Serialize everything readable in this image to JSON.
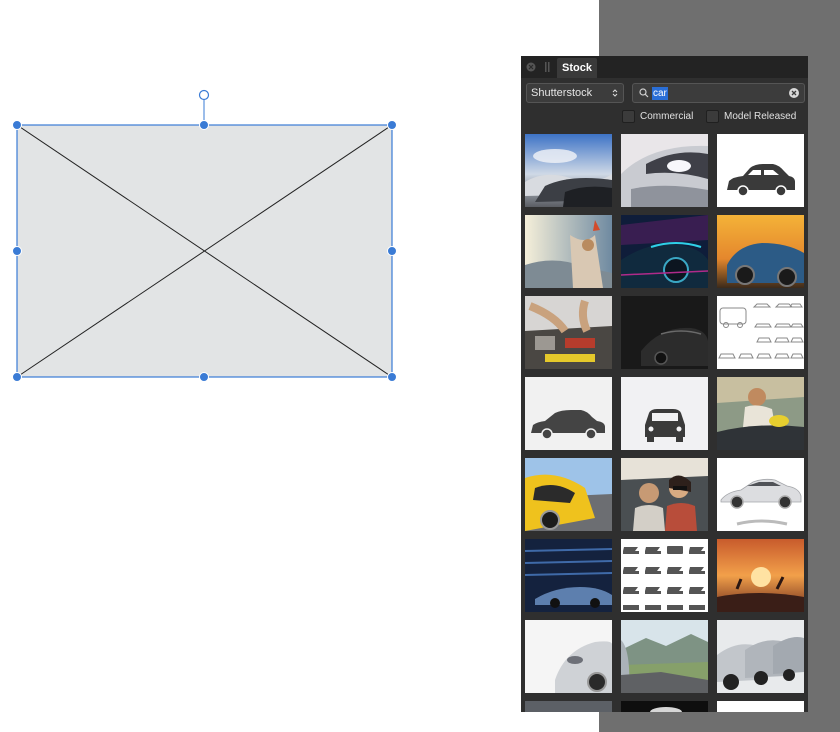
{
  "stock_panel": {
    "tab_title": "Stock",
    "source": "Shutterstock",
    "search_query": "car",
    "filters": [
      {
        "label": "Commercial",
        "checked": false
      },
      {
        "label": "Model Released",
        "checked": false
      }
    ],
    "thumbnails": [
      "cars-parked-row-photo",
      "car-headlight-closeup-photo",
      "car-silhouette-icon",
      "woman-in-car-sunset-photo",
      "dark-sports-car-neon-photo",
      "blue-car-sunset-photo",
      "mechanic-engine-repair-photo",
      "black-car-dark-photo",
      "car-outline-icons-set",
      "car-silhouette-icon-side",
      "car-front-icon",
      "man-washing-car-photo",
      "yellow-car-road-photo",
      "couple-driving-car-photo",
      "white-sedan-photo",
      "car-motion-blur-photo",
      "car-icons-grid",
      "friends-car-sunset-photo",
      "white-car-front-photo",
      "car-mountain-road-photo",
      "cars-dealership-row-photo",
      "partial-thumbnail",
      "partial-thumbnail",
      "partial-thumbnail"
    ]
  }
}
